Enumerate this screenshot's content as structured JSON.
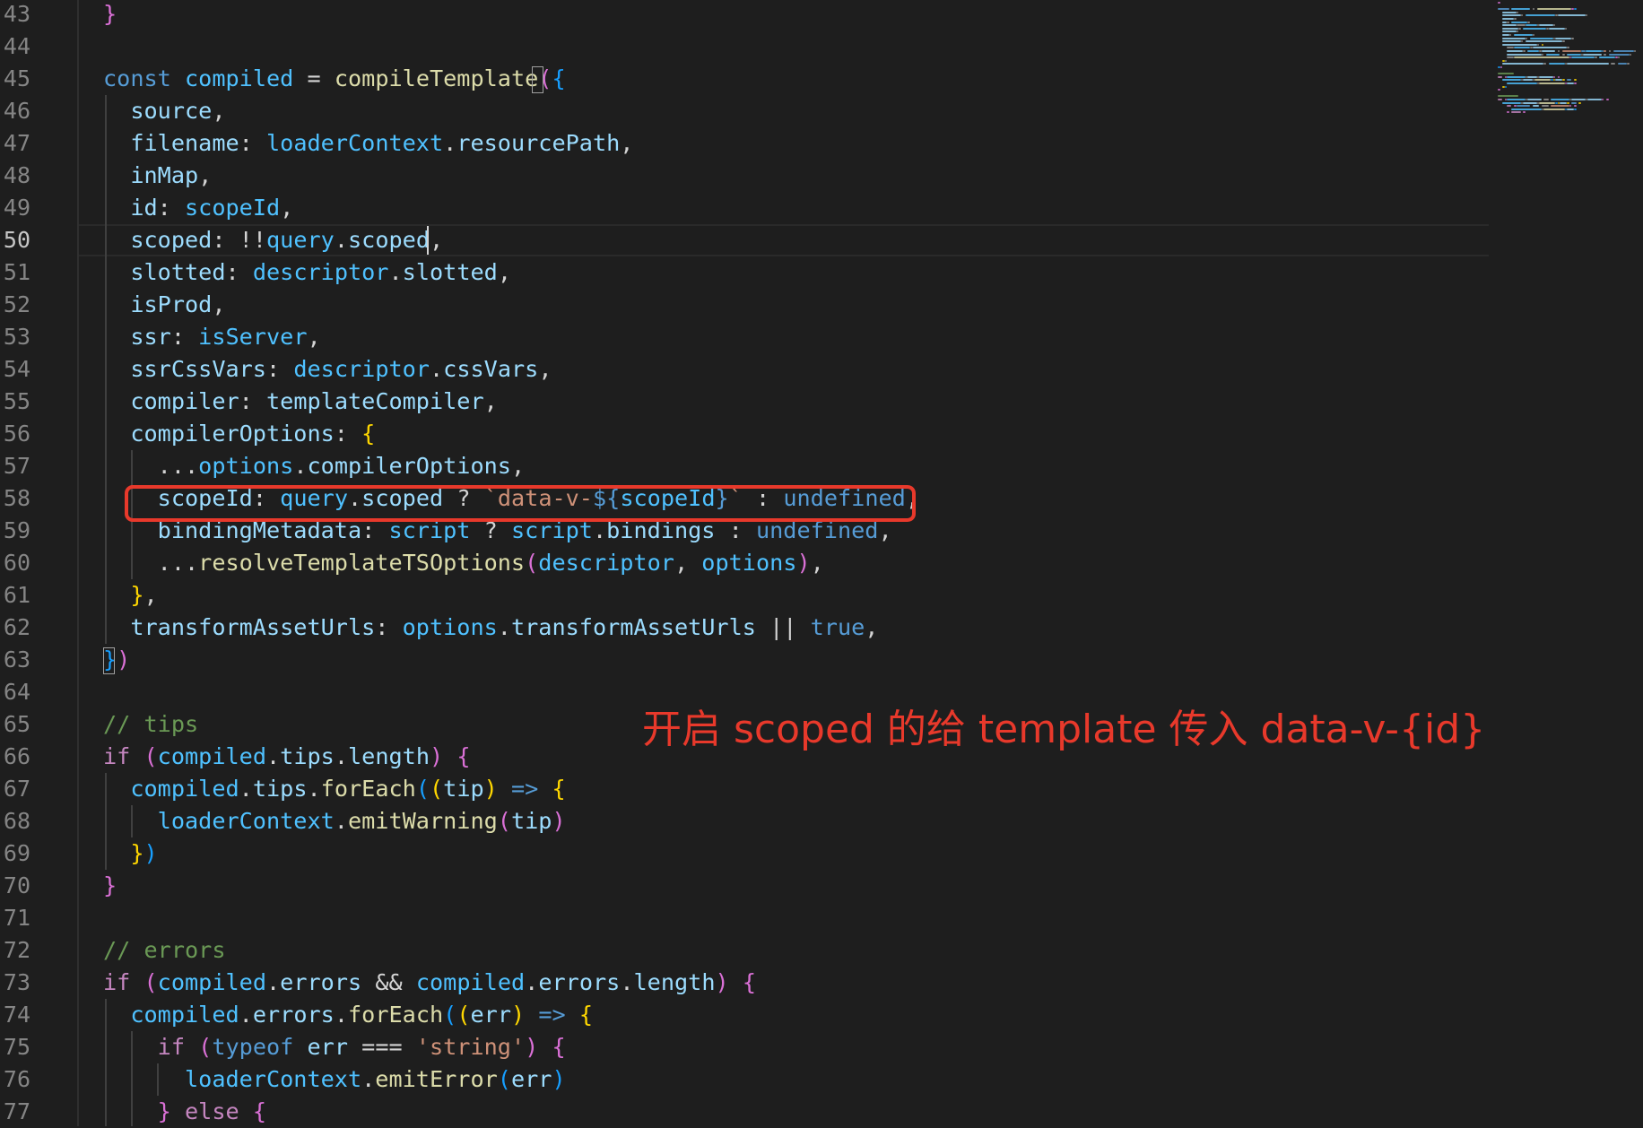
{
  "editor": {
    "active_line": "50",
    "gutter": [
      "43",
      "44",
      "45",
      "46",
      "47",
      "48",
      "49",
      "50",
      "51",
      "52",
      "53",
      "54",
      "55",
      "56",
      "57",
      "58",
      "59",
      "60",
      "61",
      "62",
      "63",
      "64",
      "65",
      "66",
      "67",
      "68",
      "69",
      "70",
      "71",
      "72",
      "73",
      "74",
      "75",
      "76",
      "77"
    ]
  },
  "code": {
    "lines": [
      [
        [
          "}",
          "b2"
        ]
      ],
      [],
      [
        [
          "const ",
          "kw"
        ],
        [
          "compiled",
          "var"
        ],
        [
          " = ",
          "pl"
        ],
        [
          "compileTemplate",
          "fn"
        ],
        [
          "(",
          "b2"
        ],
        [
          "{",
          "b3"
        ]
      ],
      [
        [
          "  source",
          "prop"
        ],
        [
          ",",
          "pl"
        ]
      ],
      [
        [
          "  filename",
          "prop"
        ],
        [
          ": ",
          "pl"
        ],
        [
          "loaderContext",
          "var"
        ],
        [
          ".",
          "pl"
        ],
        [
          "resourcePath",
          "prop"
        ],
        [
          ",",
          "pl"
        ]
      ],
      [
        [
          "  inMap",
          "prop"
        ],
        [
          ",",
          "pl"
        ]
      ],
      [
        [
          "  id",
          "prop"
        ],
        [
          ": ",
          "pl"
        ],
        [
          "scopeId",
          "var"
        ],
        [
          ",",
          "pl"
        ]
      ],
      [
        [
          "  scoped",
          "prop"
        ],
        [
          ": !!",
          "pl"
        ],
        [
          "query",
          "var"
        ],
        [
          ".",
          "pl"
        ],
        [
          "scoped",
          "prop"
        ],
        [
          ",",
          "pl"
        ]
      ],
      [
        [
          "  slotted",
          "prop"
        ],
        [
          ": ",
          "pl"
        ],
        [
          "descriptor",
          "var"
        ],
        [
          ".",
          "pl"
        ],
        [
          "slotted",
          "prop"
        ],
        [
          ",",
          "pl"
        ]
      ],
      [
        [
          "  isProd",
          "prop"
        ],
        [
          ",",
          "pl"
        ]
      ],
      [
        [
          "  ssr",
          "prop"
        ],
        [
          ": ",
          "pl"
        ],
        [
          "isServer",
          "var"
        ],
        [
          ",",
          "pl"
        ]
      ],
      [
        [
          "  ssrCssVars",
          "prop"
        ],
        [
          ": ",
          "pl"
        ],
        [
          "descriptor",
          "var"
        ],
        [
          ".",
          "pl"
        ],
        [
          "cssVars",
          "prop"
        ],
        [
          ",",
          "pl"
        ]
      ],
      [
        [
          "  compiler",
          "prop"
        ],
        [
          ": ",
          "pl"
        ],
        [
          "templateCompiler",
          "prop"
        ],
        [
          ",",
          "pl"
        ]
      ],
      [
        [
          "  compilerOptions",
          "prop"
        ],
        [
          ": ",
          "pl"
        ],
        [
          "{",
          "b1"
        ]
      ],
      [
        [
          "    ...",
          "pl"
        ],
        [
          "options",
          "var"
        ],
        [
          ".",
          "pl"
        ],
        [
          "compilerOptions",
          "prop"
        ],
        [
          ",",
          "pl"
        ]
      ],
      [
        [
          "    scopeId",
          "prop"
        ],
        [
          ": ",
          "pl"
        ],
        [
          "query",
          "var"
        ],
        [
          ".",
          "pl"
        ],
        [
          "scoped",
          "prop"
        ],
        [
          " ? ",
          "pl"
        ],
        [
          "`data-v-",
          "str"
        ],
        [
          "${",
          "kw"
        ],
        [
          "scopeId",
          "var"
        ],
        [
          "}",
          "kw"
        ],
        [
          "`",
          "str"
        ],
        [
          " : ",
          "pl"
        ],
        [
          "undefined",
          "kw"
        ],
        [
          ",",
          "pl"
        ]
      ],
      [
        [
          "    bindingMetadata",
          "prop"
        ],
        [
          ": ",
          "pl"
        ],
        [
          "script",
          "var"
        ],
        [
          " ? ",
          "pl"
        ],
        [
          "script",
          "var"
        ],
        [
          ".",
          "pl"
        ],
        [
          "bindings",
          "prop"
        ],
        [
          " : ",
          "pl"
        ],
        [
          "undefined",
          "kw"
        ],
        [
          ",",
          "pl"
        ]
      ],
      [
        [
          "    ...",
          "pl"
        ],
        [
          "resolveTemplateTSOptions",
          "fn"
        ],
        [
          "(",
          "b2"
        ],
        [
          "descriptor",
          "var"
        ],
        [
          ", ",
          "pl"
        ],
        [
          "options",
          "var"
        ],
        [
          ")",
          "b2"
        ],
        [
          ",",
          "pl"
        ]
      ],
      [
        [
          "  ",
          "pl"
        ],
        [
          "}",
          "b1"
        ],
        [
          ",",
          "pl"
        ]
      ],
      [
        [
          "  transformAssetUrls",
          "prop"
        ],
        [
          ": ",
          "pl"
        ],
        [
          "options",
          "var"
        ],
        [
          ".",
          "pl"
        ],
        [
          "transformAssetUrls",
          "prop"
        ],
        [
          " || ",
          "pl"
        ],
        [
          "true",
          "kw"
        ],
        [
          ",",
          "pl"
        ]
      ],
      [
        [
          "}",
          "b3"
        ],
        [
          ")",
          "b2"
        ]
      ],
      [],
      [
        [
          "// tips",
          "cm"
        ]
      ],
      [
        [
          "if ",
          "ctl"
        ],
        [
          "(",
          "b2"
        ],
        [
          "compiled",
          "var"
        ],
        [
          ".",
          "pl"
        ],
        [
          "tips",
          "prop"
        ],
        [
          ".",
          "pl"
        ],
        [
          "length",
          "prop"
        ],
        [
          ")",
          "b2"
        ],
        [
          " ",
          "pl"
        ],
        [
          "{",
          "b2"
        ]
      ],
      [
        [
          "  compiled",
          "var"
        ],
        [
          ".",
          "pl"
        ],
        [
          "tips",
          "prop"
        ],
        [
          ".",
          "pl"
        ],
        [
          "forEach",
          "fn"
        ],
        [
          "(",
          "b3"
        ],
        [
          "(",
          "b1"
        ],
        [
          "tip",
          "prop"
        ],
        [
          ")",
          "b1"
        ],
        [
          " => ",
          "kw"
        ],
        [
          "{",
          "b1"
        ]
      ],
      [
        [
          "    loaderContext",
          "var"
        ],
        [
          ".",
          "pl"
        ],
        [
          "emitWarning",
          "fn"
        ],
        [
          "(",
          "b2"
        ],
        [
          "tip",
          "prop"
        ],
        [
          ")",
          "b2"
        ]
      ],
      [
        [
          "  ",
          "pl"
        ],
        [
          "}",
          "b1"
        ],
        [
          ")",
          "b3"
        ]
      ],
      [
        [
          "}",
          "b2"
        ]
      ],
      [],
      [
        [
          "// errors",
          "cm"
        ]
      ],
      [
        [
          "if ",
          "ctl"
        ],
        [
          "(",
          "b2"
        ],
        [
          "compiled",
          "var"
        ],
        [
          ".",
          "pl"
        ],
        [
          "errors",
          "prop"
        ],
        [
          " && ",
          "pl"
        ],
        [
          "compiled",
          "var"
        ],
        [
          ".",
          "pl"
        ],
        [
          "errors",
          "prop"
        ],
        [
          ".",
          "pl"
        ],
        [
          "length",
          "prop"
        ],
        [
          ")",
          "b2"
        ],
        [
          " ",
          "pl"
        ],
        [
          "{",
          "b2"
        ]
      ],
      [
        [
          "  compiled",
          "var"
        ],
        [
          ".",
          "pl"
        ],
        [
          "errors",
          "prop"
        ],
        [
          ".",
          "pl"
        ],
        [
          "forEach",
          "fn"
        ],
        [
          "(",
          "b3"
        ],
        [
          "(",
          "b1"
        ],
        [
          "err",
          "prop"
        ],
        [
          ")",
          "b1"
        ],
        [
          " => ",
          "kw"
        ],
        [
          "{",
          "b1"
        ]
      ],
      [
        [
          "    if ",
          "ctl"
        ],
        [
          "(",
          "b2"
        ],
        [
          "typeof ",
          "kw"
        ],
        [
          "err",
          "prop"
        ],
        [
          " === ",
          "pl"
        ],
        [
          "'string'",
          "str"
        ],
        [
          ")",
          "b2"
        ],
        [
          " ",
          "pl"
        ],
        [
          "{",
          "b2"
        ]
      ],
      [
        [
          "      loaderContext",
          "var"
        ],
        [
          ".",
          "pl"
        ],
        [
          "emitError",
          "fn"
        ],
        [
          "(",
          "b3"
        ],
        [
          "err",
          "prop"
        ],
        [
          ")",
          "b3"
        ]
      ],
      [
        [
          "    ",
          "pl"
        ],
        [
          "}",
          "b2"
        ],
        [
          " else ",
          "ctl"
        ],
        [
          "{",
          "b2"
        ]
      ]
    ]
  },
  "annotation": {
    "text": "开启 scoped 的给 template 传入 data-v-{id}",
    "color": "#e8392b"
  }
}
